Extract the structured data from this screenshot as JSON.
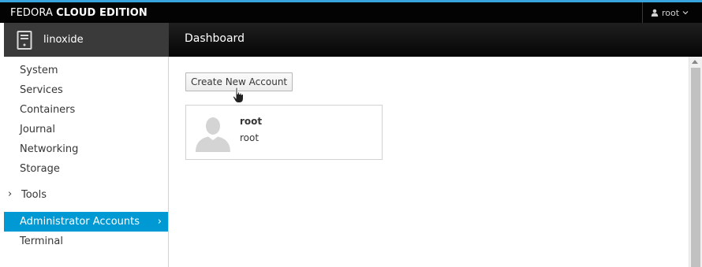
{
  "topbar": {
    "brand_regular": "FEDORA",
    "brand_bold": "CLOUD EDITION",
    "user": "root",
    "user_icon": "person-icon",
    "accent": "#39a5dc"
  },
  "host": {
    "name": "linoxide",
    "icon": "server-icon"
  },
  "header": {
    "title": "Dashboard"
  },
  "sidebar": {
    "items": [
      {
        "label": "System"
      },
      {
        "label": "Services"
      },
      {
        "label": "Containers"
      },
      {
        "label": "Journal"
      },
      {
        "label": "Networking"
      },
      {
        "label": "Storage"
      },
      {
        "label": "Tools"
      },
      {
        "label": "Administrator Accounts",
        "active": true
      },
      {
        "label": "Terminal"
      }
    ],
    "active_color": "#0099d3"
  },
  "main": {
    "create_button_label": "Create New Account",
    "accounts": [
      {
        "full_name": "root",
        "login": "root",
        "avatar_icon": "default-user-avatar-icon"
      }
    ]
  }
}
